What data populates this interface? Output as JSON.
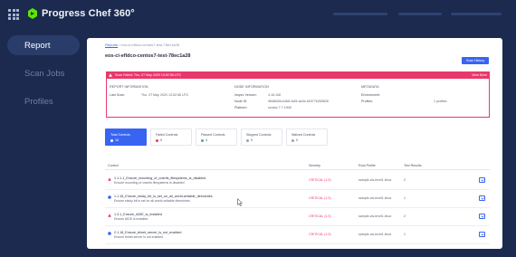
{
  "header": {
    "logo_text": "Progress Chef 360°",
    "colors": {
      "background": "#1b2a4e",
      "accent": "#3864f2",
      "critical": "#e8386a"
    }
  },
  "sidebar": {
    "items": [
      {
        "label": "Report",
        "active": true
      },
      {
        "label": "Scan Jobs",
        "active": false
      },
      {
        "label": "Profiles",
        "active": false
      }
    ]
  },
  "breadcrumb": {
    "parent": "Reports",
    "separator": "/",
    "current": "eos-ci-efldco-centos7-test-78ec1a28"
  },
  "page": {
    "title": "eos-ci-efldco-centos7-test-78ec1a28",
    "scan_history_label": "Scan History"
  },
  "banner": {
    "text": "Scan Failed: Thu, 07 May 2020 13:52:56 UTC",
    "view_more": "View More"
  },
  "report_info": {
    "report_title": "REPORT INFORMATION",
    "last_scan_label": "Last Scan:",
    "last_scan_value": "Thu, 07 May 2020 13:52:56 UTC",
    "node_title": "NODE INFORMATION",
    "inspec_label": "Inspec Version:",
    "inspec_value": "4.18.108",
    "node_id_label": "Node ID:",
    "node_id_value": "9848f40b-b4b8-4d0f-ae4b-b0377b269828",
    "platform_label": "Platform:",
    "platform_value": "centos 7.7.1908",
    "meta_title": "METADATA",
    "env_label": "Environment:",
    "profiles_label": "Profiles:",
    "profiles_value": "1 profiles"
  },
  "filter_cards": [
    {
      "label": "Total Controls",
      "count": "18",
      "dot": "#ffffff",
      "active": true
    },
    {
      "label": "Failed Controls",
      "count": "9",
      "dot": "#e8386a",
      "active": false
    },
    {
      "label": "Passed Controls",
      "count": "4",
      "dot": "#3fb57b",
      "active": false
    },
    {
      "label": "Skipped Controls",
      "count": "0",
      "dot": "#9aa1b3",
      "active": false
    },
    {
      "label": "Waived Controls",
      "count": "0",
      "dot": "#9aa1b3",
      "active": false
    }
  ],
  "table": {
    "headers": {
      "control": "Control",
      "severity": "Severity",
      "root_profile": "Root Profile",
      "test_results": "Test Results"
    },
    "rows": [
      {
        "status": "failed",
        "title": "1.1.1.1_Ensure_mounting_of_cramfs_filesystems_is_disabled",
        "desc": "Ensure mounting of cramfs filesystems is disabled",
        "severity": "CRITICAL (1.0)",
        "profile": "sample-cis-level1-linux",
        "results": "2"
      },
      {
        "status": "passed",
        "title": "1.1.18_Ensure_sticky_bit_is_set_on_all_world-writable_directories",
        "desc": "Ensure sticky bit is set on all world-writable directories",
        "severity": "CRITICAL (1.0)",
        "profile": "sample-cis-level1-linux",
        "results": "1"
      },
      {
        "status": "failed",
        "title": "1.3.1_Ensure_AIDE_is_installed",
        "desc": "Ensure AIDE is installed",
        "severity": "CRITICAL (1.0)",
        "profile": "sample-cis-level1-linux",
        "results": "2"
      },
      {
        "status": "passed",
        "title": "2.1.18_Ensure_telnet_server_is_not_enabled",
        "desc": "Ensure telnet server is not enabled",
        "severity": "CRITICAL (1.0)",
        "profile": "sample-cis-level1-linux",
        "results": "1"
      }
    ]
  }
}
